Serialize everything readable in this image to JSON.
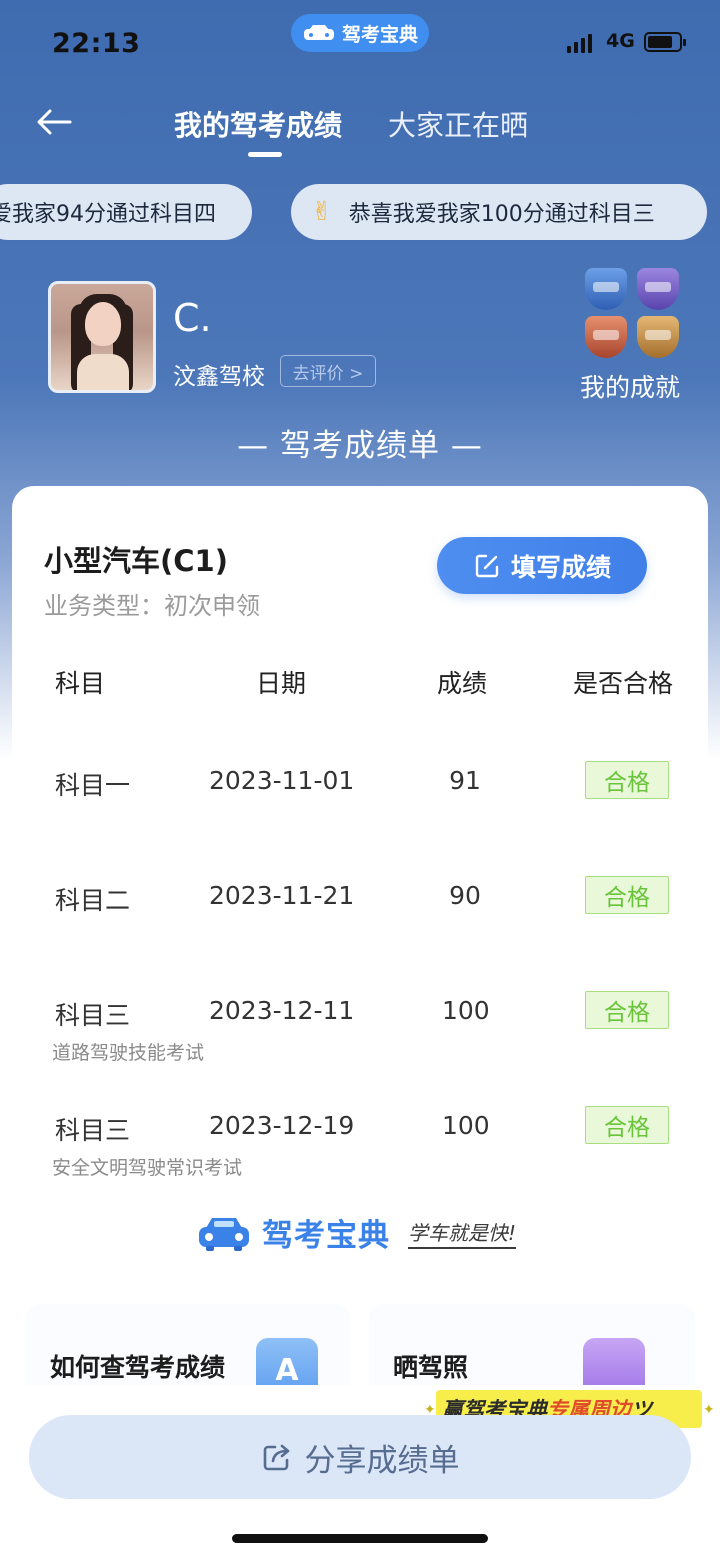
{
  "status_bar": {
    "time": "22:13",
    "app_badge": "驾考宝典",
    "network": "4G"
  },
  "nav": {
    "tab_active": "我的驾考成绩",
    "tab_other": "大家正在晒"
  },
  "tickers": [
    {
      "text": "爱我家94分通过科目四"
    },
    {
      "icon": "✌",
      "text": "恭喜我爱我家100分通过科目三"
    }
  ],
  "profile": {
    "name": "C.",
    "school": "汶鑫驾校",
    "review_label": "去评价 >",
    "achievements_label": "我的成就"
  },
  "sheet": {
    "title": "— 驾考成绩单 —",
    "vehicle": "小型汽车(C1)",
    "business_type": "业务类型：初次申领",
    "fill_button": "填写成绩",
    "headers": {
      "subject": "科目",
      "date": "日期",
      "score": "成绩",
      "passed": "是否合格"
    },
    "rows": [
      {
        "subject": "科目一",
        "date": "2023-11-01",
        "score": "91",
        "note": "",
        "passed": "合格"
      },
      {
        "subject": "科目二",
        "date": "2023-11-21",
        "score": "90",
        "note": "",
        "passed": "合格"
      },
      {
        "subject": "科目三",
        "date": "2023-12-11",
        "score": "100",
        "note": "道路驾驶技能考试",
        "passed": "合格"
      },
      {
        "subject": "科目三",
        "date": "2023-12-19",
        "score": "100",
        "note": "安全文明驾驶常识考试",
        "passed": "合格"
      }
    ],
    "brand_name": "驾考宝典",
    "brand_slogan": "学车就是快!"
  },
  "tiles": {
    "check_scores": "如何查驾考成绩",
    "check_scores_icon": "A",
    "show_license": "晒驾照"
  },
  "promo": {
    "part1": "赢驾考宝典",
    "part2": "专属周边",
    "tail": "ツ"
  },
  "share_button": "分享成绩单",
  "colors": {
    "hero_blue": "#3f6bb0",
    "accent_blue": "#3f7fe8",
    "pass_green": "#6ac43a",
    "promo_yellow": "#f7ed4b"
  }
}
